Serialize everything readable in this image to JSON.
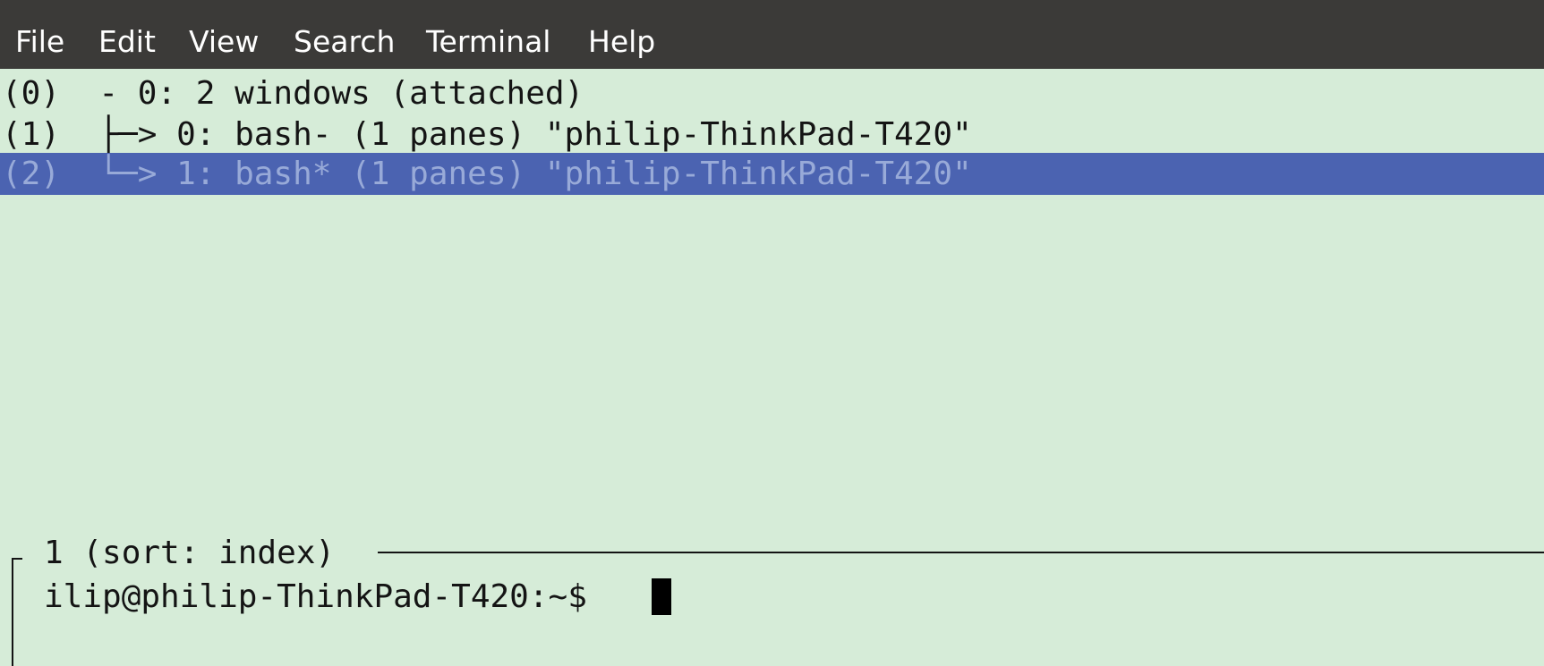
{
  "menubar": {
    "items": [
      "File",
      "Edit",
      "View",
      "Search",
      "Terminal",
      "Help"
    ]
  },
  "tree": {
    "lines": [
      "(0)  - 0: 2 windows (attached)",
      "(1)  ├─> 0: bash- (1 panes) \"philip-ThinkPad-T420\"",
      "(2)  └─> 1: bash* (1 panes) \"philip-ThinkPad-T420\""
    ],
    "selected_index": 2
  },
  "pane": {
    "title": "1 (sort: index)",
    "prompt": "ilip@philip-ThinkPad-T420:~$"
  },
  "colors": {
    "menubar_bg": "#3b3a38",
    "terminal_bg": "#d6ecd8",
    "selection_bg": "#4b63b1",
    "selection_fg": "#98aad8",
    "text": "#141414"
  },
  "icons": {
    "cursor": "block-cursor"
  }
}
